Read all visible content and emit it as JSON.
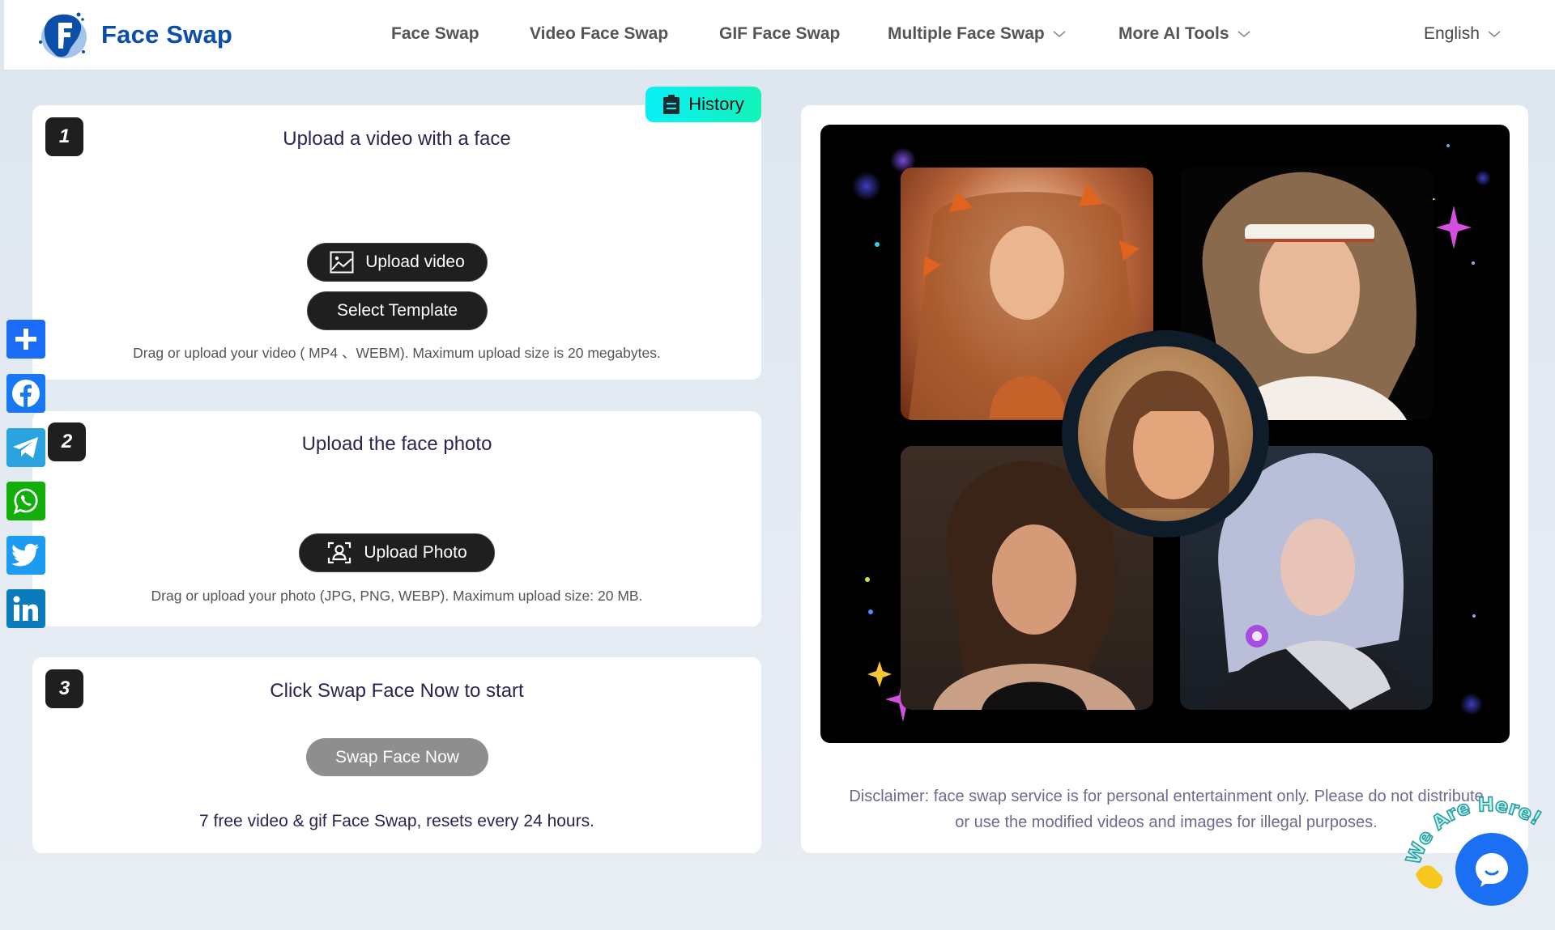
{
  "header": {
    "logo_text": "Face Swap",
    "nav": [
      {
        "label": "Face Swap",
        "has_dropdown": false
      },
      {
        "label": "Video Face Swap",
        "has_dropdown": false
      },
      {
        "label": "GIF Face Swap",
        "has_dropdown": false
      },
      {
        "label": "Multiple Face Swap",
        "has_dropdown": true
      },
      {
        "label": "More AI Tools",
        "has_dropdown": true
      }
    ],
    "language": "English"
  },
  "history_button": {
    "label": "History",
    "icon": "clipboard-icon"
  },
  "steps": [
    {
      "number": "1",
      "title": "Upload a video with a face",
      "buttons": [
        {
          "label": "Upload video",
          "icon": "image-icon"
        },
        {
          "label": "Select Template"
        }
      ],
      "hint": "Drag or upload your video ( MP4 、WEBM). Maximum upload size is 20 megabytes."
    },
    {
      "number": "2",
      "title": "Upload the face photo",
      "buttons": [
        {
          "label": "Upload Photo",
          "icon": "face-scan-icon"
        }
      ],
      "hint": "Drag or upload your photo (JPG, PNG, WEBP). Maximum upload size: 20 MB."
    },
    {
      "number": "3",
      "title": "Click Swap Face Now to start",
      "buttons": [
        {
          "label": "Swap Face Now",
          "disabled": true
        }
      ],
      "hint": "7 free video & gif Face Swap, resets every 24 hours."
    }
  ],
  "social_share": [
    {
      "name": "share",
      "icon": "plus-icon",
      "color": "#1a6cf6"
    },
    {
      "name": "facebook",
      "icon": "facebook-icon",
      "color": "#1877f2"
    },
    {
      "name": "telegram",
      "icon": "telegram-icon",
      "color": "#2aa3df"
    },
    {
      "name": "whatsapp",
      "icon": "whatsapp-icon",
      "color": "#12af0a"
    },
    {
      "name": "twitter",
      "icon": "twitter-icon",
      "color": "#1d9bf0"
    },
    {
      "name": "linkedin",
      "icon": "linkedin-icon",
      "color": "#0a7bbd"
    }
  ],
  "preview": {
    "alt": "Face swap example collage: one source face swapped into four styled portraits"
  },
  "disclaimer": "Disclaimer: face swap service is for personal entertainment only. Please do not distribute or use the modified videos and images for illegal purposes.",
  "chat_widget": {
    "label": "We Are Here!",
    "icon": "chat-bubble-icon"
  },
  "colors": {
    "brand": "#0b4fa8",
    "history_gradient_start": "#08f0f7",
    "history_gradient_end": "#13f3b9",
    "button_dark": "#1f1f1f",
    "button_disabled": "#8e8e8e",
    "chat_blue": "#1a6ff2"
  }
}
